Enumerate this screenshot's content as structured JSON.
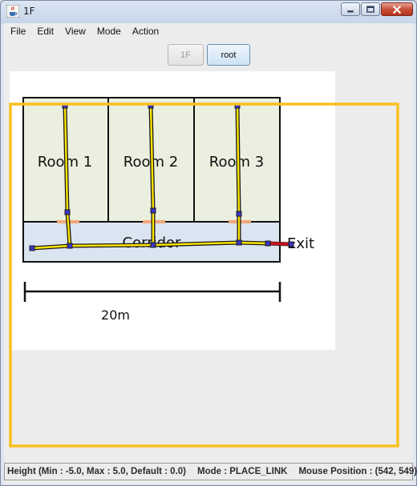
{
  "window": {
    "title": "1F",
    "icon": "java-cup-icon"
  },
  "title_buttons": [
    "minimize-icon",
    "maximize-icon",
    "close-icon"
  ],
  "menu": [
    "File",
    "Edit",
    "View",
    "Mode",
    "Action"
  ],
  "toolbar": {
    "floor_label": "1F",
    "root_label": "root"
  },
  "floor_plan": {
    "rooms": [
      "Room 1",
      "Room 2",
      "Room 3"
    ],
    "corridor_label": "Corridor",
    "exit_label": "Exit",
    "scale_label": "20m"
  },
  "status": {
    "height": "Height (Min : -5.0, Max : 5.0, Default : 0.0)",
    "mode": "Mode : PLACE_LINK",
    "mouse_position": "Mouse Position : (542, 549)"
  },
  "colors": {
    "room_fill": "#ebefdf",
    "corridor_fill": "#dbe5f1",
    "link_yellow": "#ffe500",
    "node_blue": "#3c35c8",
    "door_orange": "#f0a878",
    "exit_red": "#c0141e",
    "selection_orange": "#f8c020"
  }
}
